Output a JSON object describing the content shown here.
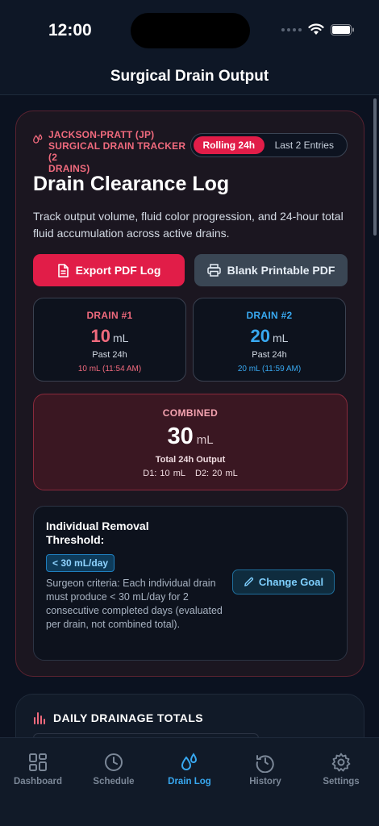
{
  "status_bar": {
    "time": "12:00"
  },
  "nav": {
    "title": "Surgical Drain Output"
  },
  "tracker": {
    "label_line1": "JACKSON-PRATT (JP)",
    "label_line2": "SURGICAL DRAIN TRACKER (2",
    "label_line3": "DRAINS)",
    "segments": [
      "Rolling 24h",
      "Last 2 Entries"
    ],
    "active_segment": "Rolling 24h",
    "title": "Drain Clearance Log",
    "description": "Track output volume, fluid color progression, and 24-hour total fluid accumulation across active drains.",
    "export_label": "Export PDF Log",
    "blank_label": "Blank Printable PDF"
  },
  "drains": [
    {
      "name": "DRAIN #1",
      "value": "10",
      "unit": "mL",
      "period": "Past 24h",
      "last_entry": "10 mL (11:54 AM)",
      "color": "#f06a7d"
    },
    {
      "name": "DRAIN #2",
      "value": "20",
      "unit": "mL",
      "period": "Past 24h",
      "last_entry": "20 mL (11:59 AM)",
      "color": "#38a8f0"
    }
  ],
  "combined": {
    "label": "COMBINED",
    "value": "30",
    "unit": "mL",
    "subtitle": "Total 24h Output",
    "d1": "D1: 10 mL",
    "d2": "D2: 20 mL"
  },
  "threshold": {
    "title": "Individual Removal Threshold:",
    "badge": "< 30 mL/day",
    "description": "Surgeon criteria: Each individual drain must produce < 30 mL/day for 2 consecutive completed days (evaluated per drain, not combined total).",
    "change_label": "Change Goal"
  },
  "daily": {
    "title": "DAILY DRAINAGE TOTALS"
  },
  "tabs": [
    {
      "label": "Dashboard",
      "icon": "grid-icon",
      "active": false
    },
    {
      "label": "Schedule",
      "icon": "clock-icon",
      "active": false
    },
    {
      "label": "Drain Log",
      "icon": "drops-icon",
      "active": true
    },
    {
      "label": "History",
      "icon": "history-icon",
      "active": false
    },
    {
      "label": "Settings",
      "icon": "gear-icon",
      "active": false
    }
  ],
  "colors": {
    "accent": "#e11d48",
    "blue": "#38a8f0",
    "background": "#0b1220"
  }
}
